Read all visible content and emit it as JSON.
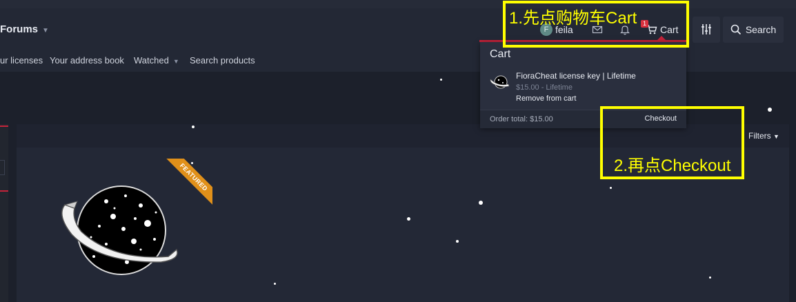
{
  "nav": {
    "forums_label": "Forums",
    "user_initial": "F",
    "username": "feila",
    "cart_label": "Cart",
    "cart_count": "1",
    "search_label": "Search"
  },
  "subnav": [
    "ur licenses",
    "Your address book",
    "Watched",
    "Search products"
  ],
  "cart_popup": {
    "title": "Cart",
    "item_name": "FioraCheat license key | Lifetime",
    "item_price": "$15.00 - Lifetime",
    "remove_label": "Remove from cart",
    "order_total": "Order total: $15.00",
    "checkout_label": "Checkout"
  },
  "filters_label": "Filters",
  "featured_ribbon": "FEATURED",
  "annotations": {
    "step1": "1.先点购物车Cart",
    "step2": "2.再点Checkout"
  },
  "colors": {
    "background": "#1c202b",
    "accent_red": "#c4233a",
    "annotation_yellow": "#ffff00",
    "ribbon_orange": "#e0901a"
  },
  "icons": [
    "caret-down-icon",
    "mail-icon",
    "bell-icon",
    "cart-icon",
    "sliders-icon",
    "search-icon"
  ]
}
